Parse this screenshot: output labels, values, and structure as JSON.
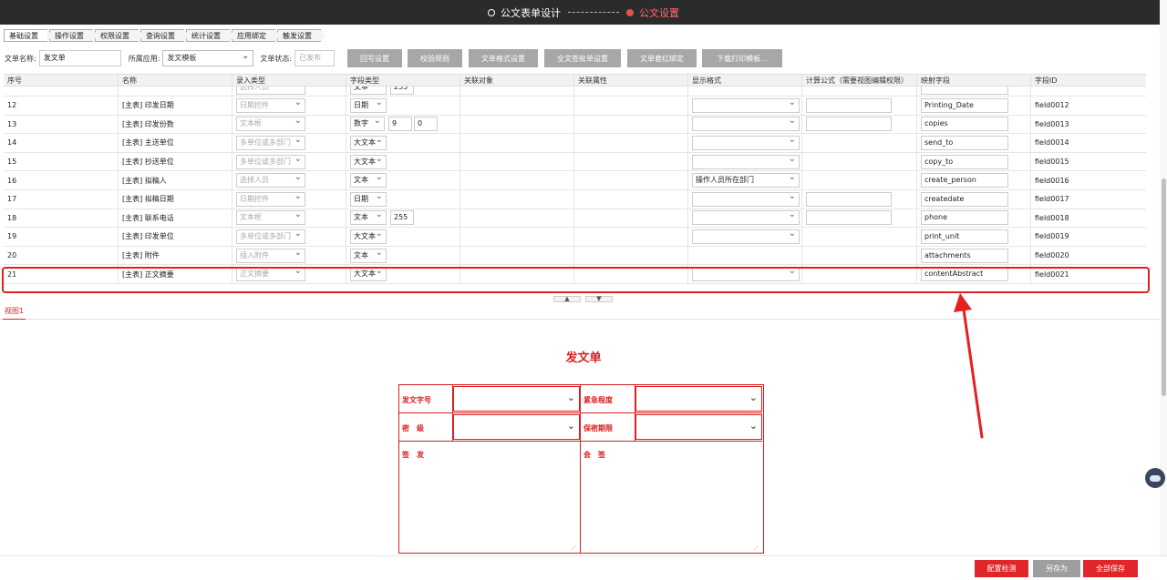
{
  "top_steps": [
    {
      "label": "公文表单设计",
      "active": false
    },
    {
      "label": "公文设置",
      "active": true
    }
  ],
  "tabs": [
    "基础设置",
    "操作设置",
    "权限设置",
    "查询设置",
    "统计设置",
    "应用绑定",
    "触发设置"
  ],
  "form": {
    "name_label": "文单名称:",
    "name_value": "发文单",
    "app_label": "所属应用:",
    "app_value": "发文模板",
    "status_label": "文单状态:",
    "status_placeholder": "已发布"
  },
  "action_buttons": [
    "回写设置",
    "校验规则",
    "文单格式设置",
    "全文签批单设置",
    "文单套红绑定",
    "下载打印模板..."
  ],
  "table": {
    "headers": [
      "序号",
      "名称",
      "录入类型",
      "字段类型",
      "关联对象",
      "关联属性",
      "显示格式",
      "计算公式（需要视图编辑权限）",
      "映射字段",
      "字段ID"
    ],
    "partial_row": {
      "input_type": "选择人员",
      "field_type": "文本",
      "length": "255"
    },
    "rows": [
      {
        "no": "12",
        "name": "[主表] 印发日期",
        "input_type": "日期控件",
        "field_type": "日期",
        "length": "",
        "decimals": "",
        "display": "",
        "formula_box": true,
        "mapping": "Printing_Date",
        "field_id": "field0012"
      },
      {
        "no": "13",
        "name": "[主表] 印发份数",
        "input_type": "文本框",
        "field_type": "数字",
        "length": "9",
        "decimals": "0",
        "display": "",
        "formula_box": true,
        "mapping": "copies",
        "field_id": "field0013"
      },
      {
        "no": "14",
        "name": "[主表] 主送单位",
        "input_type": "多单位或多部门",
        "field_type": "大文本",
        "length": "",
        "decimals": "",
        "display": "",
        "formula_box": false,
        "mapping": "send_to",
        "field_id": "field0014"
      },
      {
        "no": "15",
        "name": "[主表] 抄送单位",
        "input_type": "多单位或多部门",
        "field_type": "大文本",
        "length": "",
        "decimals": "",
        "display": "",
        "formula_box": false,
        "mapping": "copy_to",
        "field_id": "field0015"
      },
      {
        "no": "16",
        "name": "[主表] 拟稿人",
        "input_type": "选择人员",
        "field_type": "文本",
        "length": "",
        "decimals": "",
        "display": "操作人员所在部门",
        "formula_box": false,
        "mapping": "create_person",
        "field_id": "field0016"
      },
      {
        "no": "17",
        "name": "[主表] 拟稿日期",
        "input_type": "日期控件",
        "field_type": "日期",
        "length": "",
        "decimals": "",
        "display": "",
        "formula_box": true,
        "mapping": "createdate",
        "field_id": "field0017"
      },
      {
        "no": "18",
        "name": "[主表] 联系电话",
        "input_type": "文本框",
        "field_type": "文本",
        "length": "255",
        "decimals": "",
        "display": "",
        "formula_box": true,
        "mapping": "phone",
        "field_id": "field0018"
      },
      {
        "no": "19",
        "name": "[主表] 印发单位",
        "input_type": "多单位或多部门",
        "field_type": "大文本",
        "length": "",
        "decimals": "",
        "display": "",
        "formula_box": false,
        "mapping": "print_unit",
        "field_id": "field0019"
      },
      {
        "no": "20",
        "name": "[主表] 附件",
        "input_type": "插入附件",
        "field_type": "文本",
        "length": "",
        "decimals": "",
        "display": null,
        "formula_box": false,
        "mapping": "attachments",
        "field_id": "field0020"
      },
      {
        "no": "21",
        "name": "[主表] 正文摘要",
        "input_type": "正文摘要",
        "field_type": "大文本",
        "length": "",
        "decimals": "",
        "display": "",
        "formula_box": false,
        "mapping": "contentAbstract",
        "field_id": "field0021"
      }
    ]
  },
  "view_tab": "视图1",
  "document": {
    "title": "发文单",
    "labels": {
      "doc_no": "发文字号",
      "urgency": "紧急程度",
      "secret": "密　级",
      "secret_period": "保密期限",
      "issue": "签　发",
      "countersign": "会　签"
    }
  },
  "bottom_buttons": [
    {
      "label": "配置检测",
      "color": "#e0262a"
    },
    {
      "label": "另存为",
      "color": "#9e9e9e"
    },
    {
      "label": "全部保存",
      "color": "#e0262a"
    }
  ],
  "colors": {
    "accent": "#e0262a",
    "topbar": "#2b2b2b",
    "document_red": "#d81e1e"
  }
}
